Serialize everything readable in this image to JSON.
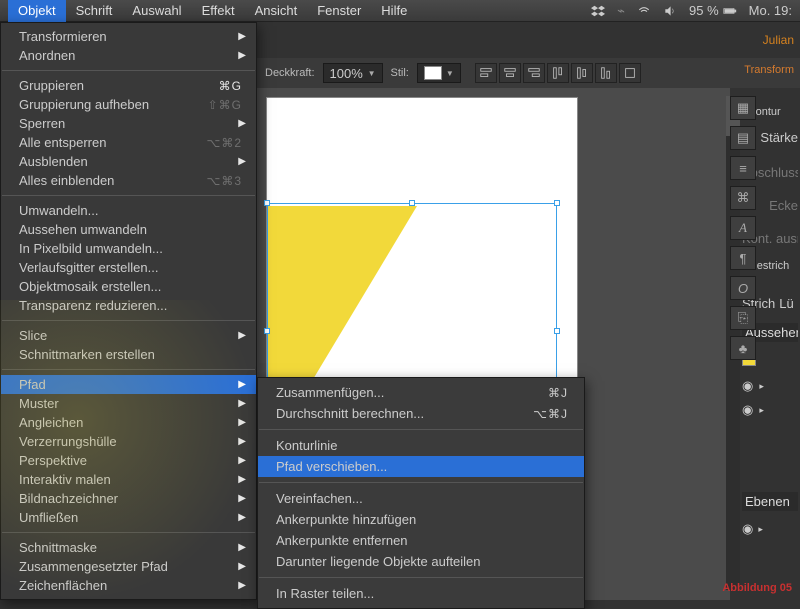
{
  "menubar": {
    "items": [
      "Objekt",
      "Schrift",
      "Auswahl",
      "Effekt",
      "Ansicht",
      "Fenster",
      "Hilfe"
    ],
    "active_index": 0,
    "status": {
      "battery": "95 %",
      "clock": "Mo. 19:",
      "user": "Julian"
    }
  },
  "dropdown": [
    {
      "label": "Transformieren",
      "arrow": true
    },
    {
      "label": "Anordnen",
      "arrow": true
    },
    {
      "sep": true
    },
    {
      "label": "Gruppieren",
      "sc": "⌘G"
    },
    {
      "label": "Gruppierung aufheben",
      "sc": "⇧⌘G",
      "disabled": true
    },
    {
      "label": "Sperren",
      "arrow": true
    },
    {
      "label": "Alle entsperren",
      "sc": "⌥⌘2",
      "disabled": true
    },
    {
      "label": "Ausblenden",
      "arrow": true
    },
    {
      "label": "Alles einblenden",
      "sc": "⌥⌘3",
      "disabled": true
    },
    {
      "sep": true
    },
    {
      "label": "Umwandeln..."
    },
    {
      "label": "Aussehen umwandeln",
      "disabled": true
    },
    {
      "label": "In Pixelbild umwandeln..."
    },
    {
      "label": "Verlaufsgitter erstellen..."
    },
    {
      "label": "Objektmosaik erstellen...",
      "disabled": true
    },
    {
      "label": "Transparenz reduzieren..."
    },
    {
      "sep": true
    },
    {
      "label": "Slice",
      "arrow": true
    },
    {
      "label": "Schnittmarken erstellen"
    },
    {
      "sep": true
    },
    {
      "label": "Pfad",
      "arrow": true,
      "hl": true
    },
    {
      "label": "Muster",
      "arrow": true
    },
    {
      "label": "Angleichen",
      "arrow": true
    },
    {
      "label": "Verzerrungshülle",
      "arrow": true
    },
    {
      "label": "Perspektive",
      "arrow": true
    },
    {
      "label": "Interaktiv malen",
      "arrow": true
    },
    {
      "label": "Bildnachzeichner",
      "arrow": true
    },
    {
      "label": "Umfließen",
      "arrow": true
    },
    {
      "sep": true
    },
    {
      "label": "Schnittmaske",
      "arrow": true
    },
    {
      "label": "Zusammengesetzter Pfad",
      "arrow": true
    },
    {
      "label": "Zeichenflächen",
      "arrow": true
    }
  ],
  "submenu": [
    {
      "label": "Zusammenfügen...",
      "sc": "⌘J"
    },
    {
      "label": "Durchschnitt berechnen...",
      "sc": "⌥⌘J"
    },
    {
      "sep": true
    },
    {
      "label": "Konturlinie"
    },
    {
      "label": "Pfad verschieben...",
      "hl": true
    },
    {
      "sep": true
    },
    {
      "label": "Vereinfachen..."
    },
    {
      "label": "Ankerpunkte hinzufügen"
    },
    {
      "label": "Ankerpunkte entfernen"
    },
    {
      "label": "Darunter liegende Objekte aufteilen"
    },
    {
      "sep": true
    },
    {
      "label": "In Raster teilen..."
    }
  ],
  "toolbar": {
    "opacity_label": "Deckkraft:",
    "opacity_value": "100%",
    "style_label": "Stil:",
    "transform_tab": "Transform"
  },
  "tabs": {
    "doc": ""
  },
  "panels": {
    "kontur": "Kontur",
    "staerke": "Stärke",
    "abschluss": "Abschluss",
    "ecke": "Ecke",
    "kont": "Kont. ausri",
    "gestrich": "Gestrich",
    "strich": "Strich",
    "lu": "Lü",
    "aussehen": "Aussehen",
    "ebenen": "Ebenen"
  },
  "caption": "Abbildung 05"
}
